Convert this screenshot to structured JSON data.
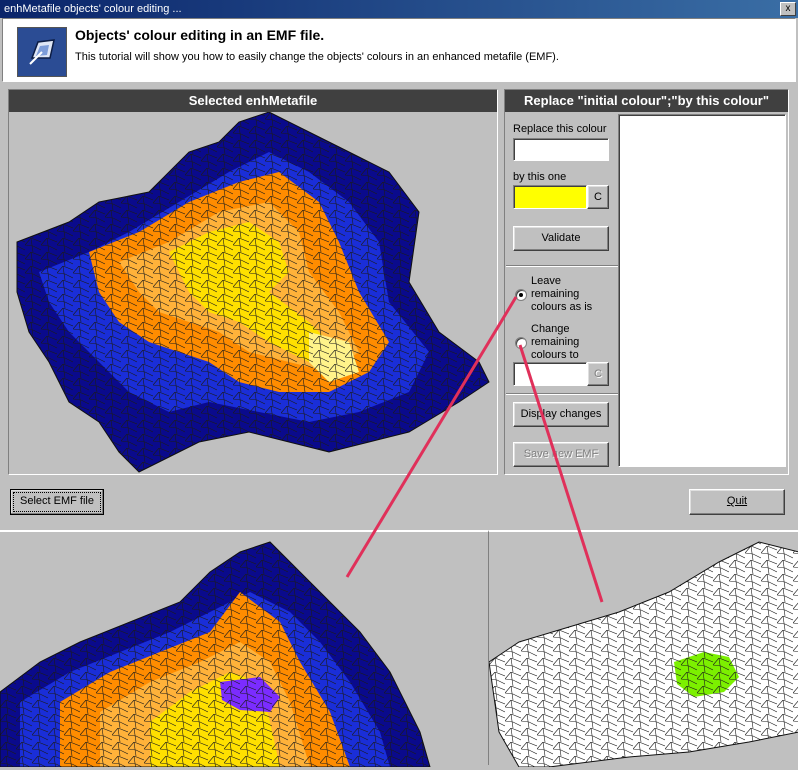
{
  "window": {
    "title": "enhMetafile objects' colour editing ...",
    "close_label": "x"
  },
  "header": {
    "title": "Objects' colour editing in an EMF file.",
    "description": "This tutorial will show you how to easily change the objects' colours in an enhanced metafile (EMF)."
  },
  "preview_panel": {
    "title": "Selected enhMetafile"
  },
  "replace_panel": {
    "title": "Replace \"initial colour\";\"by this colour\"",
    "replace_label": "Replace this colour",
    "replace_value": "",
    "by_label": "by this one",
    "by_color": "#ffff00",
    "color_button": "C",
    "validate_button": "Validate",
    "leave_option": "Leave remaining colours as is",
    "change_option": "Change remaining colours to",
    "change_color_value": "",
    "change_color_button": "C",
    "display_button": "Display changes",
    "save_button": "Save new EMF"
  },
  "footer": {
    "select_button": "Select EMF file",
    "quit_button": "Quit"
  },
  "colors": {
    "dark_blue": "#0a0a8c",
    "blue": "#1a2ed8",
    "orange": "#ff8c00",
    "light_orange": "#ffb23a",
    "yellow": "#ffe000",
    "purple": "#7b2cff",
    "green": "#7cf000",
    "annotation_red": "#e0305a"
  }
}
